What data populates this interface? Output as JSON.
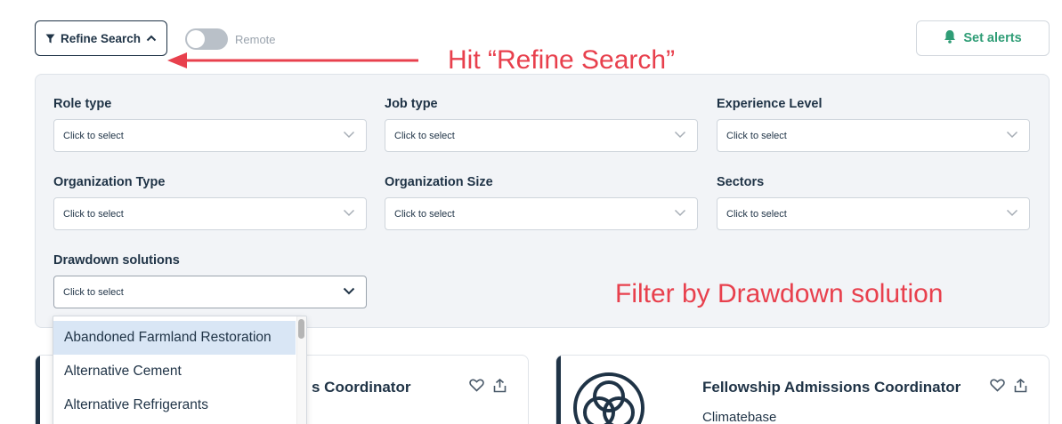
{
  "toolbar": {
    "refine_label": "Refine Search",
    "remote_label": "Remote",
    "alerts_label": "Set alerts"
  },
  "filters": {
    "role_type": {
      "label": "Role type",
      "placeholder": "Click to select"
    },
    "job_type": {
      "label": "Job type",
      "placeholder": "Click to select"
    },
    "experience_level": {
      "label": "Experience Level",
      "placeholder": "Click to select"
    },
    "organization_type": {
      "label": "Organization Type",
      "placeholder": "Click to select"
    },
    "organization_size": {
      "label": "Organization Size",
      "placeholder": "Click to select"
    },
    "sectors": {
      "label": "Sectors",
      "placeholder": "Click to select"
    },
    "drawdown_solutions": {
      "label": "Drawdown solutions",
      "placeholder": "Click to select"
    }
  },
  "dropdown": {
    "options": [
      "Abandoned Farmland Restoration",
      "Alternative Cement",
      "Alternative Refrigerants"
    ],
    "highlighted_index": 0
  },
  "annotations": {
    "refine": "Hit “Refine Search”",
    "drawdown": "Filter by Drawdown solution"
  },
  "cards": [
    {
      "title_partial": "s Coordinator"
    },
    {
      "title": "Fellowship Admissions Coordinator",
      "company": "Climatebase"
    }
  ],
  "colors": {
    "annotation": "#e8404d",
    "accent_green": "#2f9d76",
    "navy": "#1f3346"
  }
}
